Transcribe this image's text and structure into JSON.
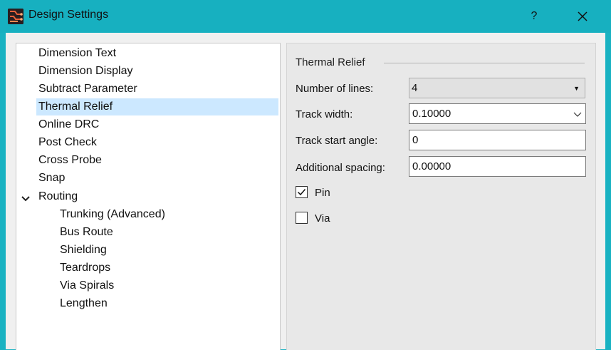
{
  "window": {
    "title": "Design Settings",
    "help_label": "?",
    "app_icon": "app-icon",
    "close_icon": "close-icon"
  },
  "tree": {
    "items": [
      {
        "label": "Dimension Text"
      },
      {
        "label": "Dimension Display"
      },
      {
        "label": "Subtract Parameter"
      },
      {
        "label": "Thermal Relief",
        "selected": true
      },
      {
        "label": "Online DRC"
      },
      {
        "label": "Post Check"
      },
      {
        "label": "Cross Probe"
      },
      {
        "label": "Snap"
      },
      {
        "label": "Routing",
        "expanded": true
      },
      {
        "label": "Trunking (Advanced)"
      },
      {
        "label": "Bus Route"
      },
      {
        "label": "Shielding"
      },
      {
        "label": "Teardrops"
      },
      {
        "label": "Via Spirals"
      },
      {
        "label": "Lengthen"
      }
    ]
  },
  "panel": {
    "group_title": "Thermal Relief",
    "number_of_lines": {
      "label": "Number of lines:",
      "value": "4"
    },
    "track_width": {
      "label": "Track width:",
      "value": "0.10000"
    },
    "track_start_angle": {
      "label": "Track start angle:",
      "value": "0"
    },
    "additional_spacing": {
      "label": "Additional spacing:",
      "value": "0.00000"
    },
    "pin": {
      "label": "Pin",
      "checked": true
    },
    "via": {
      "label": "Via",
      "checked": false
    }
  },
  "colors": {
    "title_bar": "#17b0c0",
    "selection": "#cce8ff",
    "panel_bg": "#e8e8e8"
  }
}
